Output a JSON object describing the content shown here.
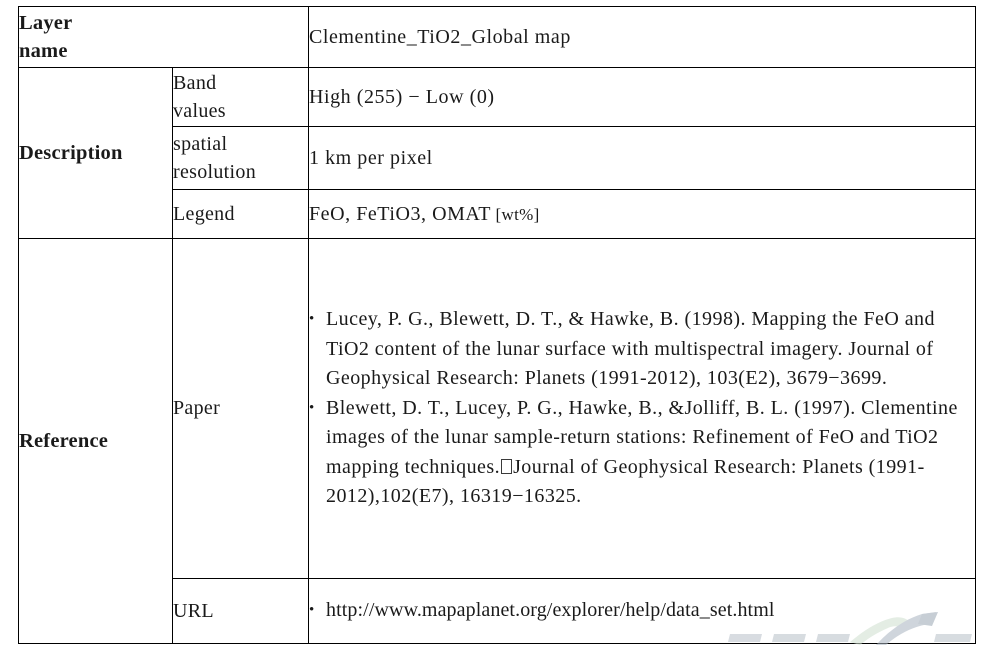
{
  "document": {
    "kind": "metadata-table",
    "colors": {
      "border": "#000000",
      "text": "#1a1a1a",
      "watermark_gray": "#b6bec7",
      "watermark_green": "#cfe0cf"
    }
  },
  "table": {
    "rows": [
      {
        "id": "layer-name",
        "label": "Layer\nname",
        "label_line1": "Layer",
        "label_line2": "name",
        "sub": null,
        "value": "Clementine_TiO2_Global map"
      },
      {
        "id": "band-values",
        "label": "Description",
        "sub_line1": "Band",
        "sub_line2": "values",
        "sub": "Band values",
        "value": "High (255) − Low (0)"
      },
      {
        "id": "spatial-resolution",
        "sub_line1": "spatial",
        "sub_line2": "resolution",
        "sub": "spatial resolution",
        "value": "1 km per pixel"
      },
      {
        "id": "legend",
        "sub": "Legend",
        "value_main": "FeO, FeTiO3, OMAT",
        "value_unit": "[wt%]"
      },
      {
        "id": "paper",
        "label": "Reference",
        "sub": "Paper",
        "references": [
          "Lucey, P. G., Blewett, D. T., & Hawke, B. (1998). Mapping the FeO and TiO2 content of the lunar surface with multispectral imagery. Journal of Geophysical Research: Planets (1991-2012), 103(E2), 3679−3699.",
          "Blewett, D. T., Lucey, P. G., Hawke, B., &Jolliff, B. L. (1997). Clementine images of the lunar sample-return stations: Refinement of FeO and TiO2 mapping techniques.□Journal of Geophysical Research: Planets (1991-2012),102(E7), 16319−16325."
        ],
        "reference_1_parts": {
          "before_box": "Lucey, P. G., Blewett, D. T., & Hawke, B. (1998). Mapping the FeO and TiO2 content of the lunar surface with multispectral imagery. Journal of Geophysical Research: Planets (1991-2012), 103(E2), 3679−3699."
        },
        "reference_2_parts": {
          "before_box": "Blewett, D. T., Lucey, P. G., Hawke, B., &Jolliff, B. L. (1997). Clementine images of the lunar sample-return stations: Refinement of FeO and TiO2 mapping techniques.",
          "after_box": "Journal of Geophysical Research: Planets (1991-2012),102(E7), 16319−16325."
        }
      },
      {
        "id": "url",
        "sub": "URL",
        "value": "http://www.mapaplanet.org/explorer/help/data_set.html"
      }
    ],
    "labels": {
      "layer_name_l1": "Layer",
      "layer_name_l2": "name",
      "description": "Description",
      "reference": "Reference"
    },
    "sub_labels": {
      "band_l1": "Band",
      "band_l2": "values",
      "spatial_l1": "spatial",
      "spatial_l2": "resolution",
      "legend": "Legend",
      "paper": "Paper",
      "url": "URL"
    },
    "values": {
      "layer_name": "Clementine_TiO2_Global map",
      "band_values": "High (255) − Low (0)",
      "spatial_resolution": "1 km per pixel",
      "legend_main": "FeO, FeTiO3, OMAT",
      "legend_unit": "[wt%]",
      "ref1": "Lucey, P. G., Blewett, D. T., & Hawke, B. (1998). Mapping the FeO and TiO2 content of the lunar surface with multispectral imagery. Journal of Geophysical Research: Planets (1991-2012), 103(E2), 3679−3699.",
      "ref2_before": "Blewett, D. T., Lucey, P. G., Hawke, B., &Jolliff, B. L. (1997). Clementine images of the lunar sample-return stations: Refinement of FeO and TiO2 mapping techniques.",
      "ref2_after": "Journal of Geophysical Research: Planets (1991-2012),102(E7), 16319−16325.",
      "url": "http://www.mapaplanet.org/explorer/help/data_set.html"
    }
  }
}
